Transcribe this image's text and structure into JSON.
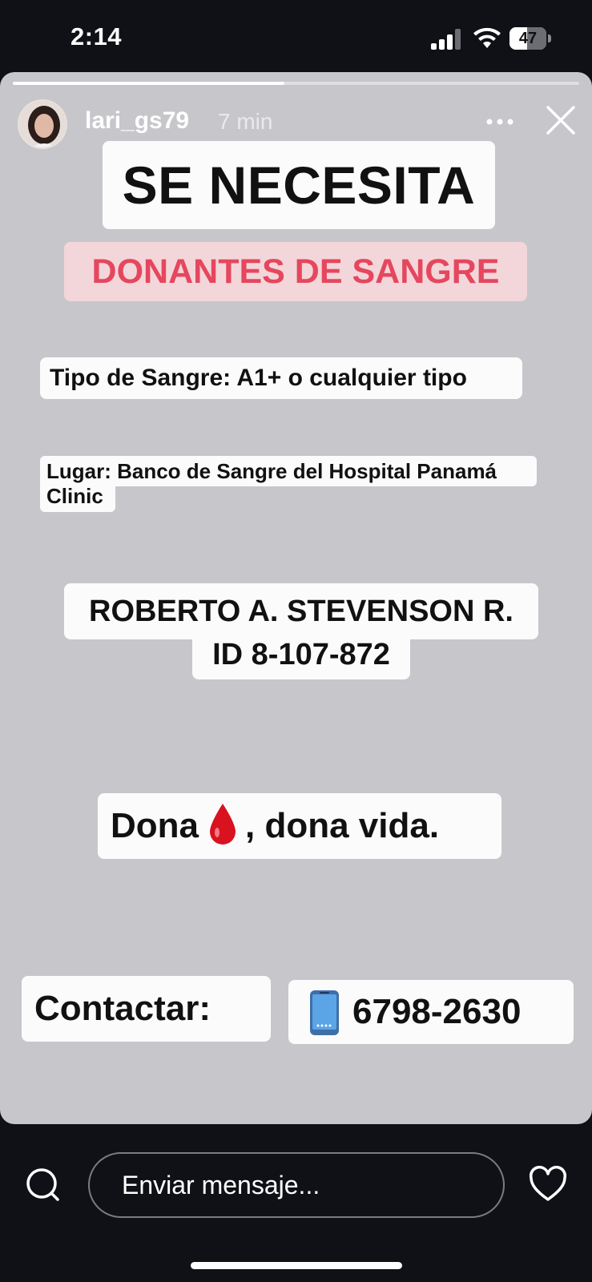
{
  "status_bar": {
    "time": "2:14",
    "battery": "47",
    "battery_level": 0.47
  },
  "story": {
    "progress": 0.48,
    "username": "lari_gs79",
    "time_ago": "7 min",
    "headline": "SE NECESITA",
    "subheadline": "DONANTES DE SANGRE",
    "blood_type": "Tipo de Sangre: A1+ o cualquier tipo",
    "place_line1": "Lugar: Banco de Sangre del Hospital Panamá",
    "place_line2": "Clinic",
    "patient_name": "ROBERTO A. STEVENSON R.",
    "patient_id": "ID 8-107-872",
    "donate_word": "Dona",
    "donate_rest": ", dona vida.",
    "contact_label": "Contactar:",
    "phone": "6798-2630",
    "colors": {
      "story_bg": "#c7c6cb",
      "donors_bg": "#f3d6da",
      "donors_text": "#e5475e"
    }
  },
  "bottom_bar": {
    "message_placeholder": "Enviar mensaje..."
  }
}
